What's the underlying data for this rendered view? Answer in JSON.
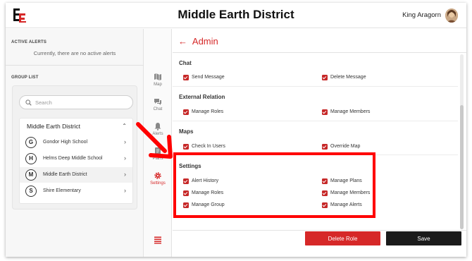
{
  "header": {
    "title": "Middle Earth District",
    "user_name": "King Aragorn"
  },
  "left_panel": {
    "active_alerts_title": "ACTIVE ALERTS",
    "no_alerts_message": "Currently, there are no active alerts",
    "group_list_title": "GROUP LIST",
    "search_placeholder": "Search",
    "district": {
      "name": "Middle Earth District",
      "schools": [
        {
          "initial": "G",
          "name": "Gondor High School",
          "active": false
        },
        {
          "initial": "H",
          "name": "Helms Deep Middle School",
          "active": false
        },
        {
          "initial": "M",
          "name": "Middle Earth District",
          "active": true
        },
        {
          "initial": "S",
          "name": "Shire Elementary",
          "active": false
        }
      ]
    }
  },
  "nav": {
    "items": [
      {
        "label": "Map",
        "icon": "map-icon"
      },
      {
        "label": "Chat",
        "icon": "chat-icon"
      },
      {
        "label": "Alerts",
        "icon": "alert-icon"
      },
      {
        "label": "Plans",
        "icon": "plans-icon"
      },
      {
        "label": "Settings",
        "icon": "gear-icon"
      }
    ],
    "bottom_icon": "list-icon"
  },
  "main": {
    "back_arrow": "←",
    "title": "Admin",
    "sections": [
      {
        "title": "Chat",
        "permissions": [
          "Send Message",
          "Delete Message"
        ]
      },
      {
        "title": "External Relation",
        "permissions": [
          "Manage Roles",
          "Manage Members"
        ]
      },
      {
        "title": "Maps",
        "permissions": [
          "Check In Users",
          "Override Map"
        ]
      },
      {
        "title": "Settings",
        "permissions": [
          "Alert History",
          "Manage Plans",
          "Manage Roles",
          "Manage Members",
          "Manage Group",
          "Manage Alerts"
        ]
      }
    ],
    "delete_button": "Delete Role",
    "save_button": "Save"
  },
  "colors": {
    "accent": "#d62828",
    "highlight": "#ff0000",
    "save_button": "#1b1b1b"
  }
}
